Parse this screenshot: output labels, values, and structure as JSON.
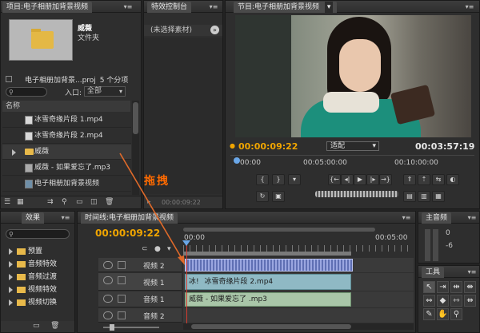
{
  "project": {
    "tab": "项目:电子相册加背景视频",
    "tab_menu": "▾≡",
    "folder_name": "威薇",
    "folder_type": "文件夹",
    "project_file": "电子相册加背景...proj",
    "item_count": "5 个分项",
    "entry_label": "入口:",
    "entry_value": "全部",
    "name_header": "名称",
    "items": [
      {
        "label": "冰雪奇缘片段 1.mp4"
      },
      {
        "label": "冰雪奇缘片段 2.mp4"
      },
      {
        "label": "威薇"
      },
      {
        "label": "威薇 - 如果爱忘了.mp3"
      },
      {
        "label": "电子相册加背景视频"
      }
    ]
  },
  "effect_controls": {
    "tab": "特效控制台",
    "tab_menu": "▾≡",
    "no_clip": "(未选择素材)",
    "footer_time": "00:00:09:22"
  },
  "monitor": {
    "tab": "节目:电子相册加背景视频",
    "current_time": "00:00:09:22",
    "fit": "适配",
    "duration": "00:03:57:19",
    "ruler": [
      "00:00",
      "00:05:00:00",
      "00:10:00:00"
    ]
  },
  "effects": {
    "tab": "效果",
    "items": [
      "预置",
      "音频特效",
      "音频过渡",
      "视频特效",
      "视频切换"
    ]
  },
  "timeline": {
    "tab": "时间线:电子相册加背景视频",
    "current_time": "00:00:09:22",
    "ruler_start": "00:00",
    "ruler_mid": "00:05:00",
    "tracks": [
      {
        "label": "视频 2"
      },
      {
        "label": "视频 1"
      },
      {
        "label": "音频 1"
      },
      {
        "label": "音频 2"
      }
    ],
    "clip_video": "冰雪奇缘片段 2.mp4",
    "clip_video_prefix": "冰!",
    "clip_audio": "威薇 - 如果爱忘了 .mp3"
  },
  "audio_master": {
    "tab": "主音频",
    "scale": [
      "0",
      "-6"
    ]
  },
  "tools": {
    "tab": "工具"
  },
  "annotation": {
    "drag_label": "拖拽"
  },
  "colors": {
    "accent": "#f0a500",
    "drag_arrow": "#e06a2a",
    "clip_video": "#8fb9c4",
    "clip_audio": "#a9c6a8",
    "playhead": "#d63b2f"
  }
}
